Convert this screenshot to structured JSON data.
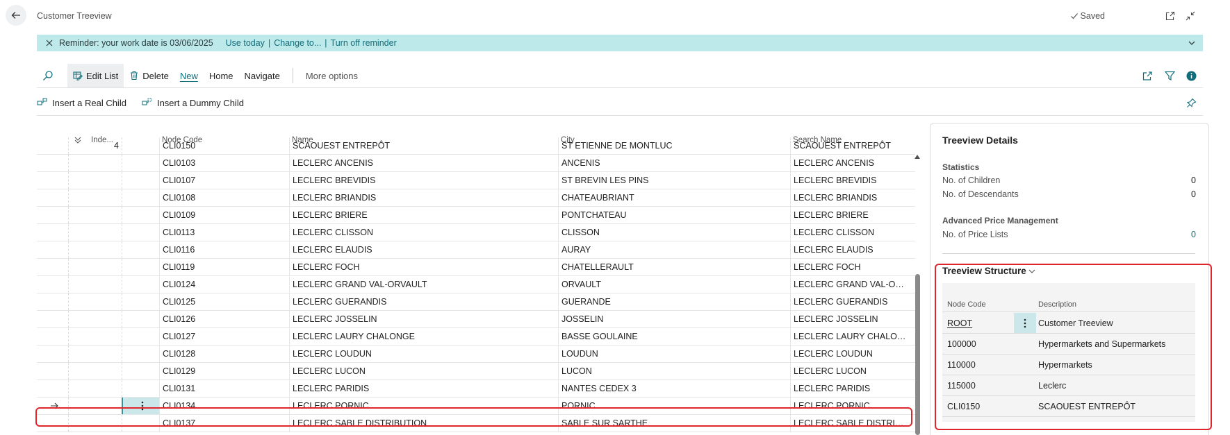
{
  "header": {
    "title": "Customer Treeview",
    "saved_label": "Saved"
  },
  "reminder": {
    "message": "Reminder: your work date is 03/06/2025",
    "links": [
      "Use today",
      "Change to...",
      "Turn off reminder"
    ]
  },
  "actions": {
    "edit_list": "Edit List",
    "delete": "Delete",
    "new": "New",
    "home": "Home",
    "navigate": "Navigate",
    "more_options": "More options"
  },
  "subactions": {
    "insert_real_child": "Insert a Real Child",
    "insert_dummy_child": "Insert a Dummy Child"
  },
  "grid": {
    "columns": [
      "Inde...",
      "Node Code",
      "Name",
      "City",
      "Search Name"
    ],
    "rows": [
      {
        "indent": "4",
        "code": "CLI0150",
        "name": "SCAOUEST ENTREPÔT",
        "city": "ST ETIENNE DE MONTLUC",
        "search": "SCAOUEST ENTREPÔT"
      },
      {
        "indent": "",
        "code": "CLI0103",
        "name": "LECLERC ANCENIS",
        "city": "ANCENIS",
        "search": "LECLERC ANCENIS"
      },
      {
        "indent": "",
        "code": "CLI0107",
        "name": "LECLERC BREVIDIS",
        "city": "ST BREVIN LES PINS",
        "search": "LECLERC BREVIDIS"
      },
      {
        "indent": "",
        "code": "CLI0108",
        "name": "LECLERC BRIANDIS",
        "city": "CHATEAUBRIANT",
        "search": "LECLERC BRIANDIS"
      },
      {
        "indent": "",
        "code": "CLI0109",
        "name": "LECLERC BRIERE",
        "city": "PONTCHATEAU",
        "search": "LECLERC BRIERE"
      },
      {
        "indent": "",
        "code": "CLI0113",
        "name": "LECLERC CLISSON",
        "city": "CLISSON",
        "search": "LECLERC CLISSON"
      },
      {
        "indent": "",
        "code": "CLI0116",
        "name": "LECLERC ELAUDIS",
        "city": "AURAY",
        "search": "LECLERC ELAUDIS"
      },
      {
        "indent": "",
        "code": "CLI0119",
        "name": "LECLERC FOCH",
        "city": "CHATELLERAULT",
        "search": "LECLERC FOCH"
      },
      {
        "indent": "",
        "code": "CLI0124",
        "name": "LECLERC GRAND VAL-ORVAULT",
        "city": "ORVAULT",
        "search": "LECLERC GRAND VAL-ORV..."
      },
      {
        "indent": "",
        "code": "CLI0125",
        "name": "LECLERC GUERANDIS",
        "city": "GUERANDE",
        "search": "LECLERC GUERANDIS"
      },
      {
        "indent": "",
        "code": "CLI0126",
        "name": "LECLERC JOSSELIN",
        "city": "JOSSELIN",
        "search": "LECLERC JOSSELIN"
      },
      {
        "indent": "",
        "code": "CLI0127",
        "name": "LECLERC LAURY CHALONGE",
        "city": "BASSE GOULAINE",
        "search": "LECLERC LAURY CHALONGE"
      },
      {
        "indent": "",
        "code": "CLI0128",
        "name": "LECLERC LOUDUN",
        "city": "LOUDUN",
        "search": "LECLERC LOUDUN"
      },
      {
        "indent": "",
        "code": "CLI0129",
        "name": "LECLERC LUCON",
        "city": "LUCON",
        "search": "LECLERC LUCON"
      },
      {
        "indent": "",
        "code": "CLI0131",
        "name": "LECLERC PARIDIS",
        "city": "NANTES CEDEX 3",
        "search": "LECLERC PARIDIS"
      },
      {
        "indent": "",
        "code": "CLI0134",
        "name": "LECLERC PORNIC",
        "city": "PORNIC",
        "search": "LECLERC PORNIC",
        "selected": true
      },
      {
        "indent": "",
        "code": "CLI0137",
        "name": "LECLERC SABLE DISTRIBUTION",
        "city": "SABLE SUR SARTHE",
        "search": "LECLERC SABLE DISTRIBUTI..."
      }
    ]
  },
  "factbox": {
    "title": "Treeview Details",
    "statistics": {
      "heading": "Statistics",
      "children_label": "No. of Children",
      "children_value": "0",
      "descendants_label": "No. of Descendants",
      "descendants_value": "0"
    },
    "advanced": {
      "heading": "Advanced Price Management",
      "price_lists_label": "No. of Price Lists",
      "price_lists_value": "0"
    },
    "structure": {
      "title": "Treeview Structure",
      "columns": [
        "Node Code",
        "Description"
      ],
      "rows": [
        {
          "code": "ROOT",
          "desc": "Customer Treeview"
        },
        {
          "code": "100000",
          "desc": "Hypermarkets and Supermarkets"
        },
        {
          "code": "110000",
          "desc": "Hypermarkets"
        },
        {
          "code": "115000",
          "desc": "Leclerc"
        },
        {
          "code": "CLI0150",
          "desc": "SCAOUEST ENTREPÔT"
        }
      ]
    }
  },
  "colors": {
    "accent": "#0f6e79",
    "reminder_bg": "#bde9ea",
    "highlight": "#e0262d"
  }
}
